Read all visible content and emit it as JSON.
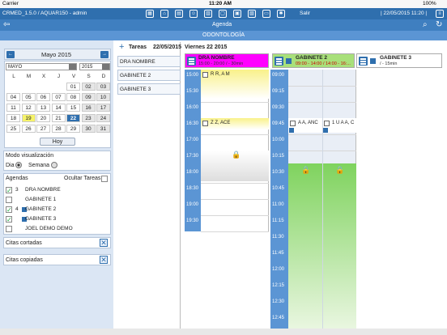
{
  "status": {
    "carrier": "Carrier",
    "time": "11:20 AM",
    "battery": "100%"
  },
  "appbar": {
    "title": "CRMED_1.5.0 / AQUAR150 - admin",
    "exit": "Salir",
    "date": "| 22/05/2015 11:20 |"
  },
  "navbar": {
    "title": "Agenda",
    "back": "⇦",
    "search": "⌕",
    "refresh": "↻"
  },
  "section": {
    "title": "ODONTOLOGÍA"
  },
  "calendar": {
    "month_label": "Mayo 2015",
    "prev": "←",
    "next": "→",
    "month_select": "MAYO",
    "year_select": "2015",
    "weekdays": [
      "L",
      "M",
      "X",
      "J",
      "V",
      "S",
      "D"
    ],
    "weeks": [
      [
        "",
        "",
        "",
        "",
        "01",
        "02",
        "03"
      ],
      [
        "04",
        "05",
        "06",
        "07",
        "08",
        "09",
        "10"
      ],
      [
        "11",
        "12",
        "13",
        "14",
        "15",
        "16",
        "17"
      ],
      [
        "18",
        "19",
        "20",
        "21",
        "22",
        "23",
        "24"
      ],
      [
        "25",
        "26",
        "27",
        "28",
        "29",
        "30",
        "31"
      ]
    ],
    "today_button": "Hoy"
  },
  "view_mode": {
    "title": "Modo visualización",
    "day": "Dia",
    "week": "Semana"
  },
  "agendas": {
    "title": "Agendas",
    "hide_tasks": "Ocultar Tareas",
    "items": [
      {
        "checked": true,
        "num": "3",
        "label": "DRA NOMBRE",
        "icon": false
      },
      {
        "checked": false,
        "num": "",
        "label": "GABINETE 1",
        "icon": false
      },
      {
        "checked": true,
        "num": "4",
        "label": "GABINETE 2",
        "icon": true
      },
      {
        "checked": true,
        "num": "",
        "label": "GABINETE 3",
        "icon": true
      },
      {
        "checked": false,
        "num": "",
        "label": "JOEL DEMO DEMO",
        "icon": false
      }
    ]
  },
  "cut_appts": {
    "title": "Citas cortadas"
  },
  "copied_appts": {
    "title": "Citas copiadas"
  },
  "tasks": {
    "title": "Tareas",
    "date": "22/05/2015",
    "items": [
      "DRA NOMBRE",
      "GABINETE 2",
      "GABINETE 3"
    ]
  },
  "agenda_view": {
    "date_title": "Viernes 22 2015",
    "columns": [
      {
        "title": "DRA NOMBRE",
        "subtitle": "15:00 - 20:00 / - 30min",
        "color": "#ff00ff"
      },
      {
        "title": "GABINETE 2",
        "subtitle": "09:00 - 14:00 / 14:00 - 16:...",
        "color": "#a8e07a"
      },
      {
        "title": "GABINETE 3",
        "subtitle": "/ - 15min",
        "color": "#ffffff"
      }
    ],
    "times_left": [
      "15:00",
      "15:30",
      "16:00",
      "16:30",
      "17:00",
      "17:30",
      "18:00",
      "18:30",
      "19:00",
      "19:30"
    ],
    "times_right": [
      "09:00",
      "09:15",
      "09:30",
      "09:45",
      "10:00",
      "10:15",
      "10:30",
      "10:45",
      "11:00",
      "11:15",
      "11:30",
      "11:45",
      "12:00",
      "12:15",
      "12:30",
      "12:45"
    ],
    "appointments": [
      {
        "label": "R R, A M",
        "col": "dra"
      },
      {
        "label": "Z Z, ACE",
        "col": "dra"
      },
      {
        "label": "A A, ANC",
        "col": "gab2"
      },
      {
        "label": "1 U A A, C",
        "col": "gab2"
      }
    ]
  },
  "colors": {
    "blue": "#2f6fae",
    "magenta": "#ff00ff",
    "green": "#a8e07a",
    "yellow": "#f6f36a"
  }
}
